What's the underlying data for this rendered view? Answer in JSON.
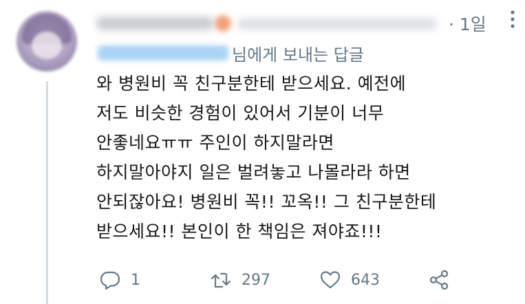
{
  "tweet": {
    "time": "· 1일",
    "replying_label": "님에게 보내는 답글",
    "body_lines": [
      "와 병원비 꼭 친구분한테 받으세요. 예전에",
      "저도 비슷한 경험이 있어서 기분이 너무",
      "안좋네요ㅠㅠ 주인이 하지말라면",
      "하지말아야지 일은 벌려놓고 나몰라라 하면",
      "안되잖아요! 병원비 꼭!! 꼬옥!! 그 친구분한테",
      "받으세요!! 본인이 한 책임은 져야죠!!!"
    ],
    "actions": {
      "reply_count": "1",
      "retweet_count": "297",
      "like_count": "643"
    }
  },
  "icons": {
    "more": "more-vertical-icon",
    "reply": "reply-bubble-icon",
    "retweet": "retweet-icon",
    "like": "heart-icon",
    "share": "share-icon"
  },
  "colors": {
    "text": "#14171a",
    "secondary": "#657786",
    "thread_line": "#d6dbe0",
    "mention_blur": "#aad3f3"
  }
}
